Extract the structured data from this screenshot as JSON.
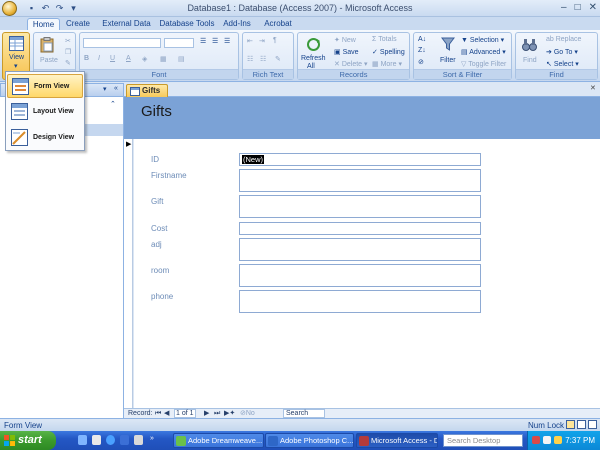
{
  "window": {
    "title": "Database1 : Database (Access 2007) - Microsoft Access"
  },
  "ribbon_tabs": [
    "Home",
    "Create",
    "External Data",
    "Database Tools",
    "Add-Ins",
    "Acrobat"
  ],
  "ribbon": {
    "view_label": "View",
    "paste_label": "Paste",
    "font_group": "Font",
    "rich_text_group": "Rich Text",
    "records_group": "Records",
    "sort_filter_group": "Sort & Filter",
    "find_group": "Find",
    "refresh_label": "Refresh",
    "refresh_all_label": "All",
    "new_label": "New",
    "save_label": "Save",
    "delete_label": "Delete",
    "totals_label": "Totals",
    "spelling_label": "Spelling",
    "more_label": "More",
    "filter_label": "Filter",
    "selection_label": "Selection",
    "advanced_label": "Advanced",
    "toggle_filter_label": "Toggle Filter",
    "find_label": "Find",
    "replace_label": "Replace",
    "goto_label": "Go To",
    "select_label": "Select"
  },
  "view_menu": {
    "items": [
      {
        "label": "Form View",
        "highlighted": true
      },
      {
        "label": "Layout View",
        "highlighted": false
      },
      {
        "label": "Design View",
        "highlighted": false
      }
    ]
  },
  "document": {
    "tab_label": "Gifts",
    "form_title": "Gifts"
  },
  "form": {
    "fields": [
      {
        "label": "ID",
        "value": "(New)"
      },
      {
        "label": "Firstname",
        "value": ""
      },
      {
        "label": "Gift",
        "value": ""
      },
      {
        "label": "Cost",
        "value": ""
      },
      {
        "label": "adj",
        "value": ""
      },
      {
        "label": "room",
        "value": ""
      },
      {
        "label": "phone",
        "value": ""
      }
    ]
  },
  "record_nav": {
    "record_label": "Record:",
    "position": "1 of 1",
    "no_filter": "No Filter",
    "search": "Search"
  },
  "status": {
    "left": "Form View",
    "num_lock": "Num Lock"
  },
  "taskbar": {
    "start": "start",
    "buttons": [
      {
        "label": "Adobe Dreamweave...",
        "active": false
      },
      {
        "label": "Adobe Photoshop C...",
        "active": false
      },
      {
        "label": "Microsoft Access - D...",
        "active": true
      }
    ],
    "search_placeholder": "Search Desktop",
    "clock": "7:37 PM"
  },
  "colors": {
    "form_header": "#7ba2d6",
    "ribbon": "#dbe6f4",
    "taskbar": "#245edb",
    "doc_tab": "#f7c95a",
    "menu_highlight": "#ffd86a"
  }
}
